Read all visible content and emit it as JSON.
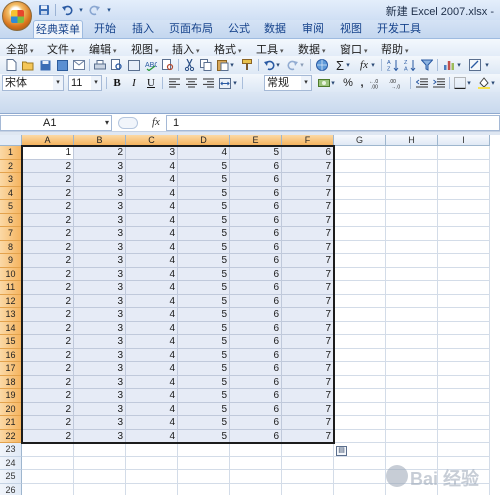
{
  "window": {
    "title": "新建 Excel 2007.xlsx -"
  },
  "quick_access": {
    "save_icon": "save-icon",
    "undo_icon": "undo-icon",
    "redo_icon": "redo-icon"
  },
  "tabs": [
    {
      "label": "经典菜单",
      "active": true
    },
    {
      "label": "开始"
    },
    {
      "label": "插入"
    },
    {
      "label": "页面布局"
    },
    {
      "label": "公式"
    },
    {
      "label": "数据"
    },
    {
      "label": "审阅"
    },
    {
      "label": "视图"
    },
    {
      "label": "开发工具"
    }
  ],
  "menus": [
    {
      "label": "全部"
    },
    {
      "label": "文件"
    },
    {
      "label": "编辑"
    },
    {
      "label": "视图"
    },
    {
      "label": "插入"
    },
    {
      "label": "格式"
    },
    {
      "label": "工具"
    },
    {
      "label": "数据"
    },
    {
      "label": "窗口"
    },
    {
      "label": "帮助"
    }
  ],
  "format_bar": {
    "font_name": "宋体",
    "font_size": "11",
    "bold": "B",
    "italic": "I",
    "underline": "U",
    "number_format": "常规",
    "percent": "%",
    "comma": ",",
    "sigma": "Σ",
    "fx": "fx"
  },
  "formula_bar": {
    "name_box": "A1",
    "fx_label": "fx",
    "formula": "1"
  },
  "grid": {
    "columns": [
      "A",
      "B",
      "C",
      "D",
      "E",
      "F",
      "G",
      "H",
      "I"
    ],
    "rows": [
      "1",
      "2",
      "3",
      "4",
      "5",
      "6",
      "7",
      "8",
      "9",
      "10",
      "11",
      "12",
      "13",
      "14",
      "15",
      "16",
      "17",
      "18",
      "19",
      "20",
      "21",
      "22",
      "23",
      "24",
      "25",
      "26",
      "27"
    ],
    "data": [
      [
        "1",
        "2",
        "3",
        "4",
        "5",
        "6"
      ],
      [
        "2",
        "3",
        "4",
        "5",
        "6",
        "7"
      ],
      [
        "2",
        "3",
        "4",
        "5",
        "6",
        "7"
      ],
      [
        "2",
        "3",
        "4",
        "5",
        "6",
        "7"
      ],
      [
        "2",
        "3",
        "4",
        "5",
        "6",
        "7"
      ],
      [
        "2",
        "3",
        "4",
        "5",
        "6",
        "7"
      ],
      [
        "2",
        "3",
        "4",
        "5",
        "6",
        "7"
      ],
      [
        "2",
        "3",
        "4",
        "5",
        "6",
        "7"
      ],
      [
        "2",
        "3",
        "4",
        "5",
        "6",
        "7"
      ],
      [
        "2",
        "3",
        "4",
        "5",
        "6",
        "7"
      ],
      [
        "2",
        "3",
        "4",
        "5",
        "6",
        "7"
      ],
      [
        "2",
        "3",
        "4",
        "5",
        "6",
        "7"
      ],
      [
        "2",
        "3",
        "4",
        "5",
        "6",
        "7"
      ],
      [
        "2",
        "3",
        "4",
        "5",
        "6",
        "7"
      ],
      [
        "2",
        "3",
        "4",
        "5",
        "6",
        "7"
      ],
      [
        "2",
        "3",
        "4",
        "5",
        "6",
        "7"
      ],
      [
        "2",
        "3",
        "4",
        "5",
        "6",
        "7"
      ],
      [
        "2",
        "3",
        "4",
        "5",
        "6",
        "7"
      ],
      [
        "2",
        "3",
        "4",
        "5",
        "6",
        "7"
      ],
      [
        "2",
        "3",
        "4",
        "5",
        "6",
        "7"
      ],
      [
        "2",
        "3",
        "4",
        "5",
        "6",
        "7"
      ],
      [
        "2",
        "3",
        "4",
        "5",
        "6",
        "7"
      ]
    ],
    "selection": "A1:F22",
    "active_cell": "A1"
  },
  "colors": {
    "selected_header": "#f5b45f",
    "selection_fill": "#e6ebf6",
    "ribbon": "#c4d7ef"
  }
}
